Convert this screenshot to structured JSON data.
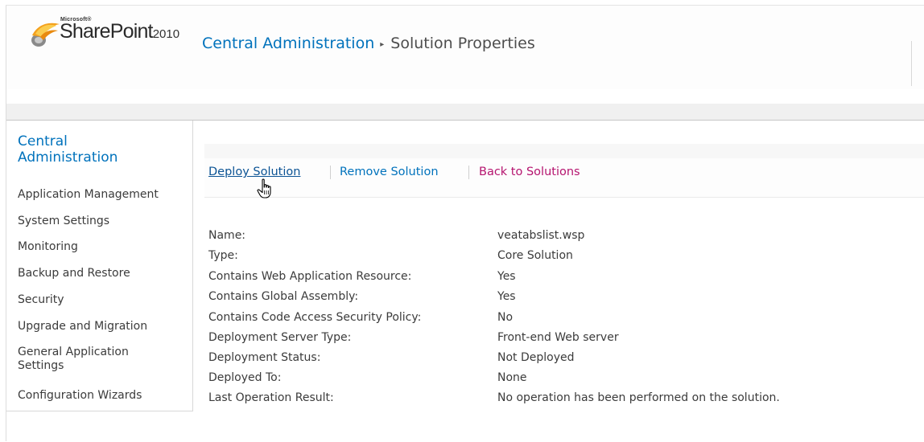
{
  "header": {
    "brand_microsoft": "Microsoft®",
    "brand_product": "SharePoint",
    "brand_year": "2010",
    "breadcrumb_root": "Central Administration",
    "breadcrumb_separator": "▸",
    "breadcrumb_current": "Solution Properties"
  },
  "quicklaunch": {
    "heading_line1": "Central",
    "heading_line2": "Administration",
    "items": [
      "Application Management",
      "System Settings",
      "Monitoring",
      "Backup and Restore",
      "Security",
      "Upgrade and Migration",
      "General Application",
      "Settings",
      "Configuration Wizards"
    ]
  },
  "toolbar": {
    "deploy_label": "Deploy Solution",
    "remove_label": "Remove Solution",
    "back_label": "Back to Solutions"
  },
  "properties": [
    {
      "label": "Name:",
      "value": "veatabslist.wsp"
    },
    {
      "label": "Type:",
      "value": "Core Solution"
    },
    {
      "label": "Contains Web Application Resource:",
      "value": "Yes"
    },
    {
      "label": "Contains Global Assembly:",
      "value": "Yes"
    },
    {
      "label": "Contains Code Access Security Policy:",
      "value": "No"
    },
    {
      "label": "Deployment Server Type:",
      "value": "Front-end Web server"
    },
    {
      "label": "Deployment Status:",
      "value": "Not Deployed"
    },
    {
      "label": "Deployed To:",
      "value": "None"
    },
    {
      "label": "Last Operation Result:",
      "value": "No operation has been performed on the solution."
    }
  ],
  "colors": {
    "link_blue": "#0072bc",
    "back_link_magenta": "#b5146f",
    "text": "#3b3b3b"
  },
  "icons": {
    "logo": "sharepoint-logo-icon",
    "cursor": "hand-pointer-cursor-icon"
  }
}
